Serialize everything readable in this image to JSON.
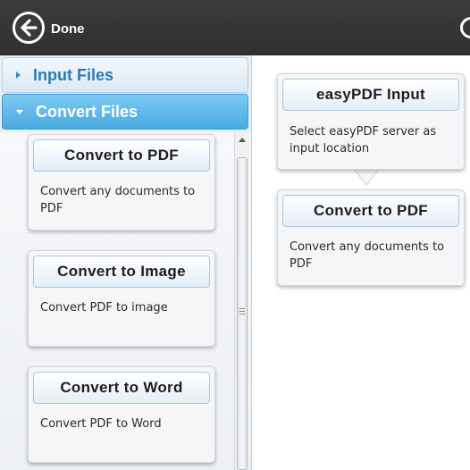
{
  "topbar": {
    "back_icon": "back-arrow-icon",
    "done_label": "Done"
  },
  "accordion": {
    "input_files_label": "Input Files",
    "convert_files_label": "Convert Files"
  },
  "convert_list": [
    {
      "title": "Convert to PDF",
      "description": "Convert any documents to PDF"
    },
    {
      "title": "Convert to Image",
      "description": "Convert PDF to image"
    },
    {
      "title": "Convert to Word",
      "description": "Convert PDF to Word"
    }
  ],
  "workflow": [
    {
      "title": "easyPDF Input",
      "description": "Select easyPDF server as input location"
    },
    {
      "title": "Convert to PDF",
      "description": "Convert any documents to PDF"
    }
  ],
  "colors": {
    "topbar": "#333333",
    "accordion_active": "#4aa9e2",
    "accordion_inactive_text": "#2a7ab8"
  }
}
